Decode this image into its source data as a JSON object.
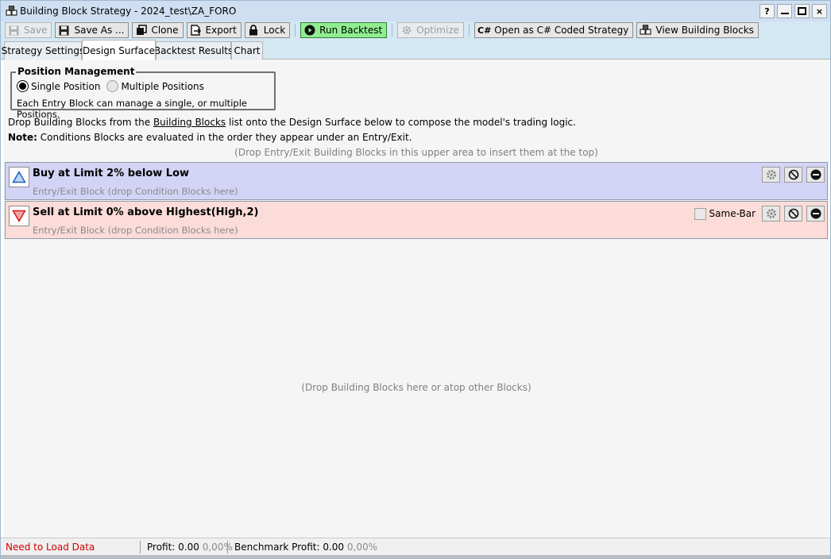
{
  "window": {
    "title": "Building Block Strategy - 2024_test\\ZA_FORO",
    "icon": "blocks-icon",
    "buttons": {
      "help": "?",
      "close": "×"
    }
  },
  "toolbar": {
    "save": "Save",
    "save_as": "Save As ...",
    "clone": "Clone",
    "export": "Export",
    "lock": "Lock",
    "run_backtest": "Run Backtest",
    "optimize": "Optimize",
    "open_csharp": "Open as C# Coded Strategy",
    "view_blocks": "View Building Blocks",
    "run_color": "#90ee90"
  },
  "tabs": [
    "Strategy Settings",
    "Design Surface",
    "Backtest Results",
    "Chart"
  ],
  "active_tab": "Design Surface",
  "position_management": {
    "title": "Position Management",
    "single": "Single Position",
    "multiple": "Multiple Positions",
    "selected": "Single Position",
    "description": "Each Entry Block can manage a single, or multiple Positions."
  },
  "instructions": {
    "line1_pre": "Drop Building Blocks from the ",
    "line1_link": "Building Blocks",
    "line1_post": " list onto the Design Surface below to compose the model's trading logic.",
    "note_label": "Note:",
    "note_text": " Conditions Blocks are evaluated in the order they appear under an Entry/Exit.",
    "top_hint": "(Drop Entry/Exit Building Blocks in this upper area to insert them at the top)"
  },
  "blocks": [
    {
      "title": "Buy at Limit 2% below Low",
      "subtitle": "Entry/Exit Block (drop Condition Blocks here)",
      "icon": "triangle-up-icon",
      "color": "#d3d4f5"
    },
    {
      "title": "Sell at Limit 0% above Highest(High,2)",
      "subtitle": "Entry/Exit Block (drop Condition Blocks here)",
      "icon": "triangle-down-icon",
      "color": "#fbdcd8",
      "same_bar_label": "Same-Bar",
      "same_bar_checked": false
    }
  ],
  "drop_hint": "(Drop Building Blocks here or atop other Blocks)",
  "status": {
    "data_status": "Need to Load Data",
    "profit_label": "Profit:",
    "profit_value": "0.00",
    "profit_pct": "0,00%",
    "benchmark_label": "Benchmark Profit:",
    "benchmark_value": "0.00",
    "benchmark_pct": "0,00%"
  }
}
